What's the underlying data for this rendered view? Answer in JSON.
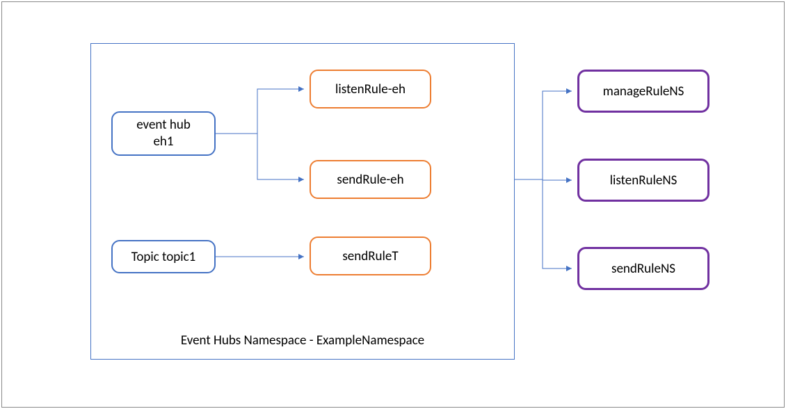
{
  "namespace": {
    "label": "Event Hubs Namespace - ExampleNamespace"
  },
  "entities": {
    "eventhub": "event hub\neh1",
    "topic": "Topic topic1"
  },
  "hub_rules": {
    "listen": "listenRule-eh",
    "send": "sendRule-eh",
    "send_topic": "sendRuleT"
  },
  "ns_rules": {
    "manage": "manageRuleNS",
    "listen": "listenRuleNS",
    "send": "sendRuleNS"
  }
}
